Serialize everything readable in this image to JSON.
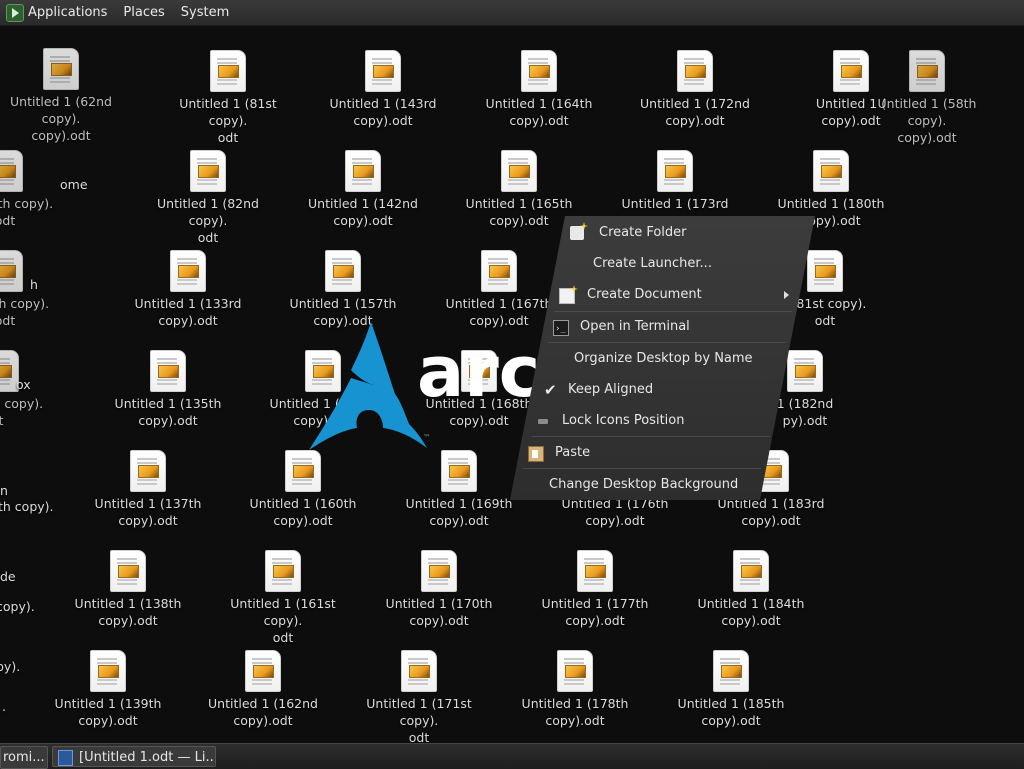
{
  "top_panel": {
    "menus": [
      "Applications",
      "Places",
      "System"
    ]
  },
  "desktop": {
    "left_fragments": [
      "Untitled 1 (62nd copy).",
      "copy).odt",
      "ome",
      "1 (148th copy).",
      "odt",
      "h",
      "1 (68th copy).",
      "odt",
      "ox",
      "(100th copy).",
      "t",
      "n",
      "th copy).",
      "de",
      "copy).",
      "py).",
      "."
    ],
    "icons": [
      {
        "l1": "Untitled 1 (81st copy).",
        "l2": "odt"
      },
      {
        "l1": "Untitled 1 (143rd",
        "l2": "copy).odt"
      },
      {
        "l1": "Untitled 1 (164th",
        "l2": "copy).odt"
      },
      {
        "l1": "Untitled 1 (172nd",
        "l2": "copy).odt"
      },
      {
        "l1": "Untitled 1 (",
        "l2": "copy).odt"
      },
      {
        "l1": "Untitled 1 (58th copy).",
        "l2": "copy).odt"
      },
      {
        "l1": "Untitled 1 (82nd copy).",
        "l2": "odt"
      },
      {
        "l1": "Untitled 1 (142nd",
        "l2": "copy).odt"
      },
      {
        "l1": "Untitled 1 (165th",
        "l2": "copy).odt"
      },
      {
        "l1": "Untitled 1 (173rd",
        "l2": ""
      },
      {
        "l1": "Untitled 1 (180th",
        "l2": "copy).odt"
      },
      {
        "l1": "Untitled 1 (133rd",
        "l2": "copy).odt"
      },
      {
        "l1": "Untitled 1 (157th",
        "l2": "copy).odt"
      },
      {
        "l1": "Untitled 1 (167th",
        "l2": "copy).odt"
      },
      {
        "l1": "(181st copy).",
        "l2": "odt"
      },
      {
        "l1": "Untitled 1 (135th",
        "l2": "copy).odt"
      },
      {
        "l1": "Untitled 1 (159th",
        "l2": "copy).odt"
      },
      {
        "l1": "Untitled 1 (168th",
        "l2": "copy).odt"
      },
      {
        "l1": "1 (182nd",
        "l2": "py).odt"
      },
      {
        "l1": "Untitled 1 (137th",
        "l2": "copy).odt"
      },
      {
        "l1": "Untitled 1 (160th",
        "l2": "copy).odt"
      },
      {
        "l1": "Untitled 1 (169th",
        "l2": "copy).odt"
      },
      {
        "l1": "Untitled 1 (176th",
        "l2": "copy).odt"
      },
      {
        "l1": "Untitled 1 (183rd",
        "l2": "copy).odt"
      },
      {
        "l1": "Untitled 1 (138th",
        "l2": "copy).odt"
      },
      {
        "l1": "Untitled 1 (161st copy).",
        "l2": "odt"
      },
      {
        "l1": "Untitled 1 (170th",
        "l2": "copy).odt"
      },
      {
        "l1": "Untitled 1 (177th",
        "l2": "copy).odt"
      },
      {
        "l1": "Untitled 1 (184th",
        "l2": "copy).odt"
      },
      {
        "l1": "Untitled 1 (139th",
        "l2": "copy).odt"
      },
      {
        "l1": "Untitled 1 (162nd",
        "l2": "copy).odt"
      },
      {
        "l1": "Untitled 1 (171st copy).",
        "l2": "odt"
      },
      {
        "l1": "Untitled 1 (178th",
        "l2": "copy).odt"
      },
      {
        "l1": "Untitled 1 (185th",
        "l2": "copy).odt"
      }
    ],
    "wallpaper_text": "arch"
  },
  "context_menu": {
    "items": [
      "Create Folder",
      "Create Launcher...",
      "Create Document",
      "Open in Terminal",
      "Organize Desktop by Name",
      "Keep Aligned",
      "Lock Icons Position",
      "Paste",
      "Change Desktop Background"
    ]
  },
  "taskbar": {
    "items": [
      "romi...",
      "[Untitled 1.odt — Li..."
    ]
  },
  "colors": {
    "desktop_bg": "#0d0d0d",
    "arch_blue": "#1793d1",
    "menu_bg": "#353535"
  }
}
